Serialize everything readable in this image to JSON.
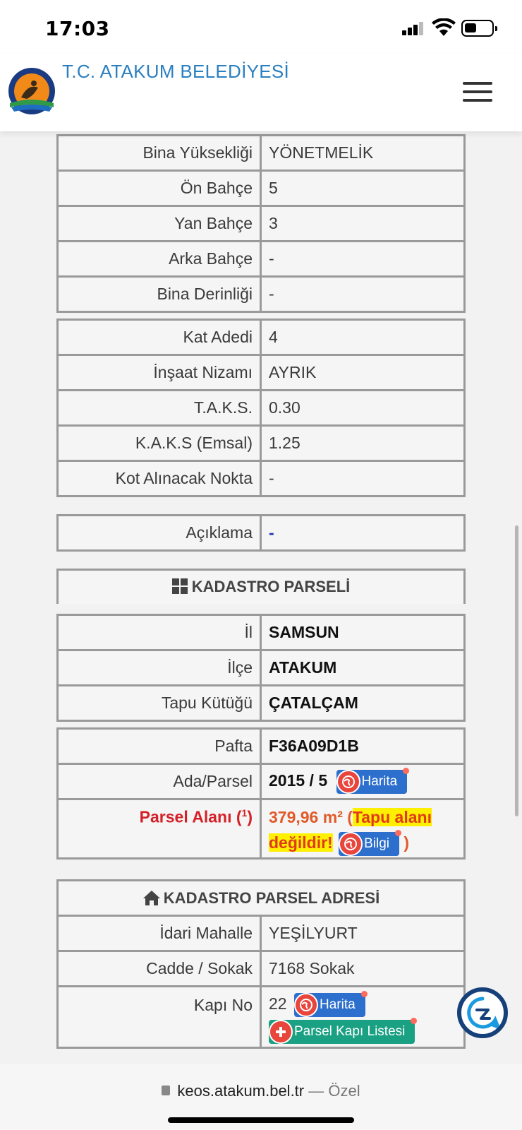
{
  "status": {
    "time": "17:03"
  },
  "header": {
    "title": "T.C. ATAKUM BELEDİYESİ"
  },
  "table1": [
    {
      "label": "Bina Yüksekliği",
      "value": "YÖNETMELİK"
    },
    {
      "label": "Ön Bahçe",
      "value": "5"
    },
    {
      "label": "Yan Bahçe",
      "value": "3"
    },
    {
      "label": "Arka Bahçe",
      "value": "-"
    },
    {
      "label": "Bina Derinliği",
      "value": "-"
    }
  ],
  "table2": [
    {
      "label": "Kat Adedi",
      "value": "4"
    },
    {
      "label": "İnşaat Nizamı",
      "value": "AYRIK"
    },
    {
      "label": "T.A.K.S.",
      "value": "0.30"
    },
    {
      "label": "K.A.K.S (Emsal)",
      "value": "1.25"
    },
    {
      "label": "Kot Alınacak Nokta",
      "value": "-"
    }
  ],
  "aciklama": {
    "label": "Açıklama",
    "value": "-"
  },
  "kadastro": {
    "title": "KADASTRO PARSELİ",
    "il": {
      "label": "İl",
      "value": "SAMSUN"
    },
    "ilce": {
      "label": "İlçe",
      "value": "ATAKUM"
    },
    "tapu": {
      "label": "Tapu Kütüğü",
      "value": "ÇATALÇAM"
    },
    "pafta": {
      "label": "Pafta",
      "value": "F36A09D1B"
    },
    "ada": {
      "label": "Ada/Parsel",
      "value": "2015 / 5",
      "button": "Harita"
    },
    "alan": {
      "label": "Parsel Alanı (",
      "sup": "1",
      "label_end": ")",
      "value": "379,96 m²",
      "open": "(",
      "note1": "Tapu alanı",
      "note2": "değildir!",
      "button": "Bilgi",
      "close": ")"
    }
  },
  "adres": {
    "title": "KADASTRO PARSEL ADRESİ",
    "mahalle": {
      "label": "İdari Mahalle",
      "value": "YEŞİLYURT"
    },
    "cadde": {
      "label": "Cadde / Sokak",
      "value": "7168 Sokak"
    },
    "kapi": {
      "label": "Kapı No",
      "value": "22",
      "button": "Harita",
      "button2": "Parsel Kapı Listesi"
    }
  },
  "browser": {
    "url": "keos.atakum.bel.tr",
    "sep": " — ",
    "mode": "Özel"
  },
  "colors": {
    "title_blue": "#2a7fc0",
    "button_blue": "#2d6fcc",
    "button_teal": "#1aa083",
    "alert_red": "#d42027",
    "highlight_yellow": "#ffef00"
  }
}
